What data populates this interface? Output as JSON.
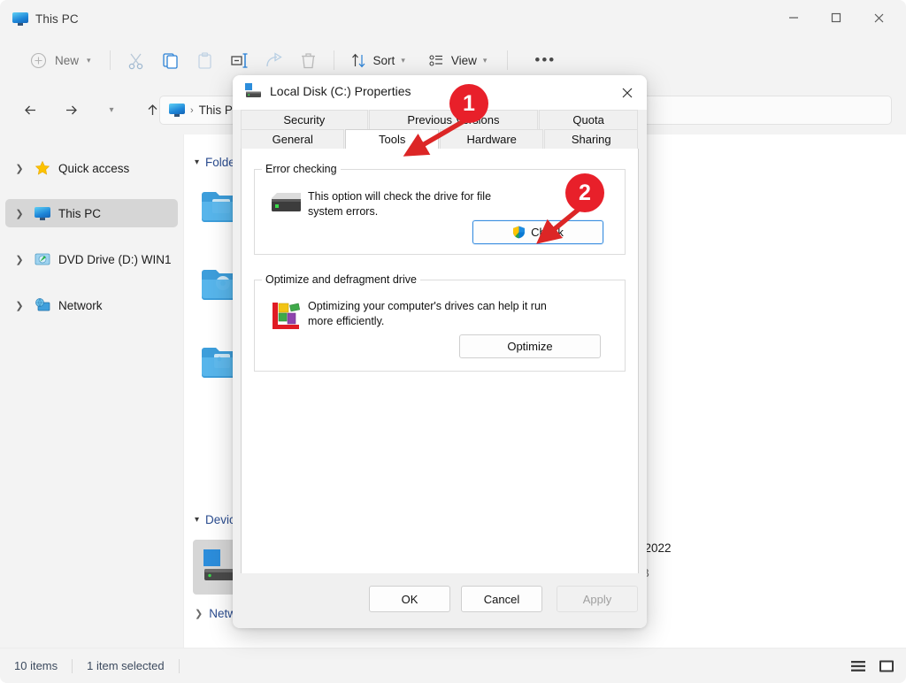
{
  "window": {
    "title": "This PC",
    "icon": "this-pc-icon",
    "controls": {
      "minimize": "—",
      "maximize": "☐",
      "close": "✕"
    }
  },
  "toolbar": {
    "new_label": "New",
    "sort_label": "Sort",
    "view_label": "View",
    "more_label": "•••",
    "icons": [
      "cut-icon",
      "copy-icon",
      "paste-icon",
      "rename-icon",
      "share-icon",
      "delete-icon"
    ]
  },
  "addressbar": {
    "back": "←",
    "forward": "→",
    "recent": "⌄",
    "up": "↑",
    "crumbs": [
      "This PC"
    ],
    "separator": "›"
  },
  "sidebar": {
    "items": [
      {
        "label": "Quick access",
        "icon": "star-icon",
        "selected": false
      },
      {
        "label": "This PC",
        "icon": "this-pc-icon",
        "selected": true
      },
      {
        "label": "DVD Drive (D:) WIN1",
        "icon": "dvd-drive-icon",
        "selected": false
      },
      {
        "label": "Network",
        "icon": "network-icon",
        "selected": false
      }
    ]
  },
  "content": {
    "groups": [
      {
        "label": "Folders",
        "expanded": true,
        "chevron": "⌄"
      },
      {
        "label": "Devices and drives",
        "expanded": true,
        "chevron": "⌄"
      },
      {
        "label": "Network locations",
        "expanded": false,
        "chevron": "›"
      }
    ],
    "drive": {
      "name": "U.SEP2022",
      "sub": "4.71 GB"
    }
  },
  "statusbar": {
    "item_count": "10 items",
    "selection": "1 item selected",
    "view_list_icon": "list-view-icon",
    "view_details_icon": "details-view-icon"
  },
  "dialog": {
    "title": "Local Disk (C:) Properties",
    "icon": "hard-disk-icon",
    "close": "✕",
    "tabs_top": [
      "Security",
      "Previous Versions",
      "Quota"
    ],
    "tabs_bottom": [
      "General",
      "Tools",
      "Hardware",
      "Sharing"
    ],
    "active_tab": "Tools",
    "error_checking": {
      "group_title": "Error checking",
      "icon": "hard-disk-icon",
      "description": "This option will check the drive for file system errors.",
      "button": "Check",
      "button_icon": "uac-shield-icon"
    },
    "optimize": {
      "group_title": "Optimize and defragment drive",
      "icon": "defrag-icon",
      "description": "Optimizing your computer's drives can help it run more efficiently.",
      "button": "Optimize"
    },
    "footer": {
      "ok": "OK",
      "cancel": "Cancel",
      "apply": "Apply",
      "apply_disabled": true
    }
  },
  "annotations": {
    "accent_color": "#e8202a",
    "steps": [
      {
        "number": "1",
        "target": "Tools tab"
      },
      {
        "number": "2",
        "target": "Check button"
      }
    ]
  }
}
